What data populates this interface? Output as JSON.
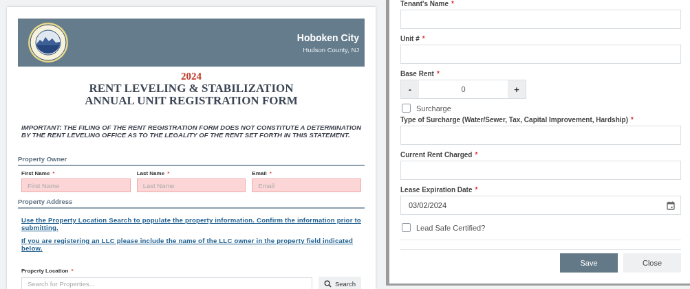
{
  "header": {
    "city": "Hoboken City",
    "county": "Hudson County, NJ"
  },
  "form_title": {
    "year": "2024",
    "line_1": "RENT LEVELING & STABILIZATION",
    "line_2": "ANNUAL UNIT REGISTRATION FORM"
  },
  "notice": "IMPORTANT: THE FILING OF THE RENT REGISTRATION FORM DOES NOT CONSTITUTE A DETERMINATION BY THE RENT LEVELING OFFICE AS TO THE LEGALITY OF THE RENT SET FORTH IN THIS STATEMENT.",
  "property_owner": {
    "title": "Property Owner",
    "fields": [
      {
        "label": "First Name",
        "required_mark": "*",
        "placeholder": "First Name",
        "invalid": true
      },
      {
        "label": "Last Name",
        "required_mark": "*",
        "placeholder": "Last Name",
        "invalid": true
      },
      {
        "label": "Email",
        "required_mark": "*",
        "placeholder": "Email",
        "invalid": true
      }
    ]
  },
  "property_address": {
    "title": "Property Address",
    "links": [
      "Use the Property Location Search to populate the property information. Confirm the information prior to submitting.",
      "If you are registering an LLC please include the name of the LLC owner in the property field indicated below."
    ],
    "location": {
      "label": "Property Location",
      "required_mark": "*",
      "placeholder": "Search for Properties..."
    },
    "search_button": "Search"
  },
  "unit_dialog": {
    "fields": [
      {
        "kind": "text",
        "label": "Tenant's Name",
        "required_mark": "*"
      },
      {
        "kind": "text",
        "label": "Unit #",
        "required_mark": "*"
      },
      {
        "kind": "stepper",
        "label": "Base Rent",
        "required_mark": "*",
        "value": "0",
        "decrement": "-",
        "increment": "+"
      },
      {
        "kind": "checkbox",
        "label": "Surcharge",
        "checked": false
      },
      {
        "kind": "text",
        "label": "Type of Surcharge (Water/Sewer, Tax, Capital Improvement, Hardship)",
        "required_mark": "*"
      },
      {
        "kind": "text",
        "label": "Current Rent Charged",
        "required_mark": "*"
      },
      {
        "kind": "date",
        "label": "Lease Expiration Date",
        "required_mark": "*",
        "value": "03/02/2024"
      },
      {
        "kind": "checkbox",
        "label": "Lead Safe Certified?",
        "checked": false
      }
    ],
    "buttons": [
      {
        "label": "Save",
        "kind": "primary"
      },
      {
        "label": "Close",
        "kind": "secondary"
      }
    ]
  }
}
